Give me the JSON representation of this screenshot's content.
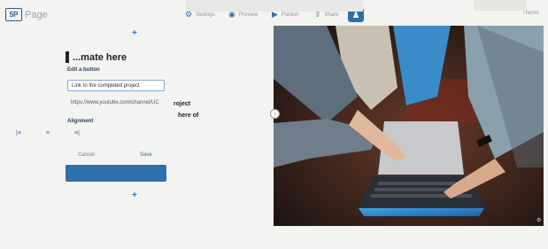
{
  "app": {
    "logo_mark": "5P",
    "name": "Page"
  },
  "toolbar": {
    "settings": "Settings",
    "preview": "Preview",
    "publish": "Publish",
    "share": "Share",
    "theme": "Theme"
  },
  "editor": {
    "heading": "...mate here",
    "section_label": "Edit a button",
    "button_text_value": "Link to the completed project",
    "button_url_value": "https://www.youtube.com/channel/UC",
    "alignment_label": "Alignment",
    "align_left": "|≡",
    "align_center": "≡",
    "align_right": "≡|",
    "cancel_label": "Cancel",
    "save_label": "Save"
  },
  "page_text": {
    "line1": "roject",
    "line2": "here of"
  },
  "icons": {
    "settings": "gear-icon",
    "preview": "eye-icon",
    "publish": "play-icon",
    "share": "upload-icon",
    "share_button": "user-icon"
  },
  "colors": {
    "accent": "#2f6fae",
    "input_border": "#8aa8cb",
    "page_bg": "#f3f3f1"
  }
}
